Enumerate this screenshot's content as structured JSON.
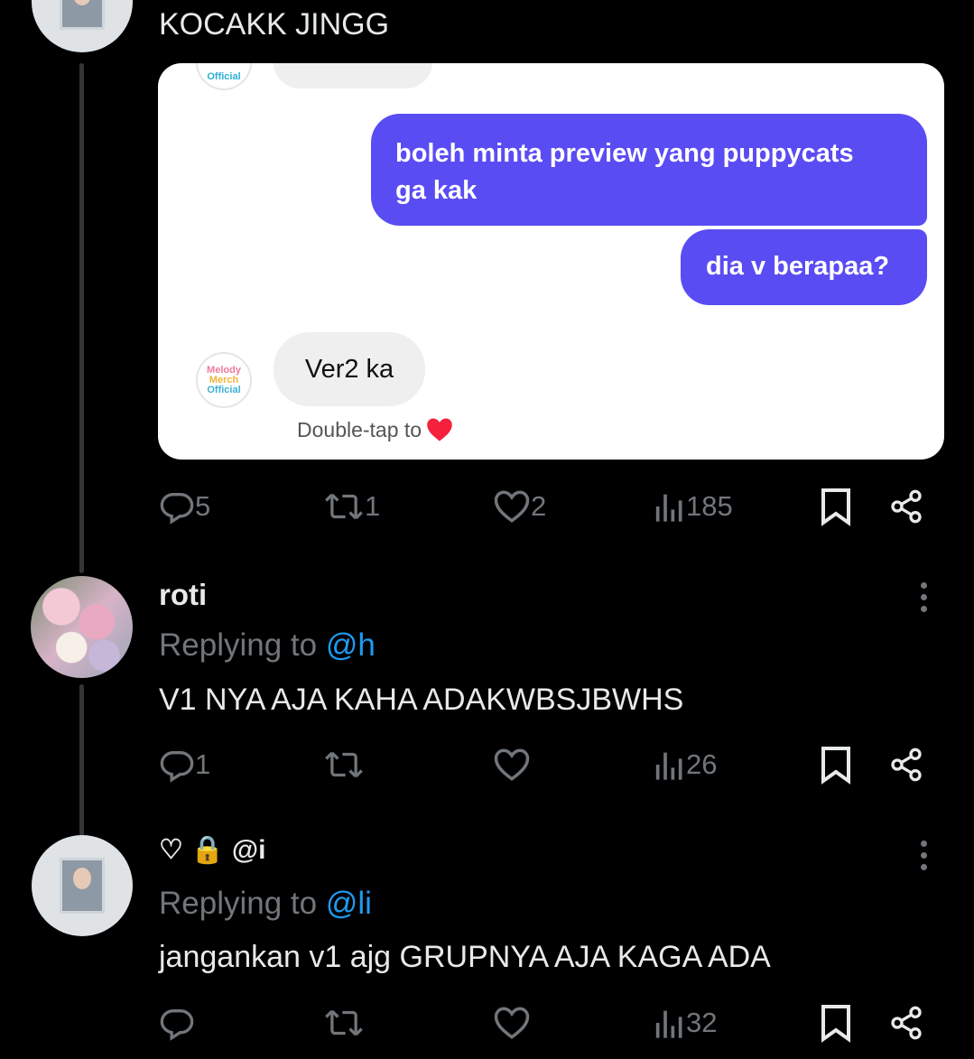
{
  "main_post": {
    "text": "KOCAKK JINGG",
    "card": {
      "top_logo_text": "Official",
      "messages_out": [
        {
          "line1": "boleh minta preview yang puppycats",
          "line2": "ga kak"
        },
        {
          "line1": "dia v berapaa?"
        }
      ],
      "logo_lines": [
        "Melody",
        "Merch",
        "Official"
      ],
      "message_in": "Ver2 ka",
      "hint": "Double-tap to"
    },
    "actions": {
      "replies": "5",
      "reposts": "1",
      "likes": "2",
      "views": "185"
    }
  },
  "replies": [
    {
      "name": "roti",
      "replying_label": "Replying to ",
      "replying_handle": "@h",
      "text": "V1 NYA AJA KAHA ADAKWBSJBWHS",
      "actions": {
        "replies": "1",
        "reposts": "",
        "likes": "",
        "views": "26"
      }
    },
    {
      "name": "♡ 🔒 @i",
      "replying_label": "Replying to ",
      "replying_handle": "@li",
      "text": "jangankan v1 ajg GRUPNYA AJA KAGA ADA",
      "actions": {
        "replies": "",
        "reposts": "",
        "likes": "",
        "views": "32"
      }
    }
  ],
  "colors": {
    "accent": "#1d9bf0",
    "bubble": "#5a4cf3",
    "muted": "#71767b",
    "heart": "#f4213c"
  }
}
